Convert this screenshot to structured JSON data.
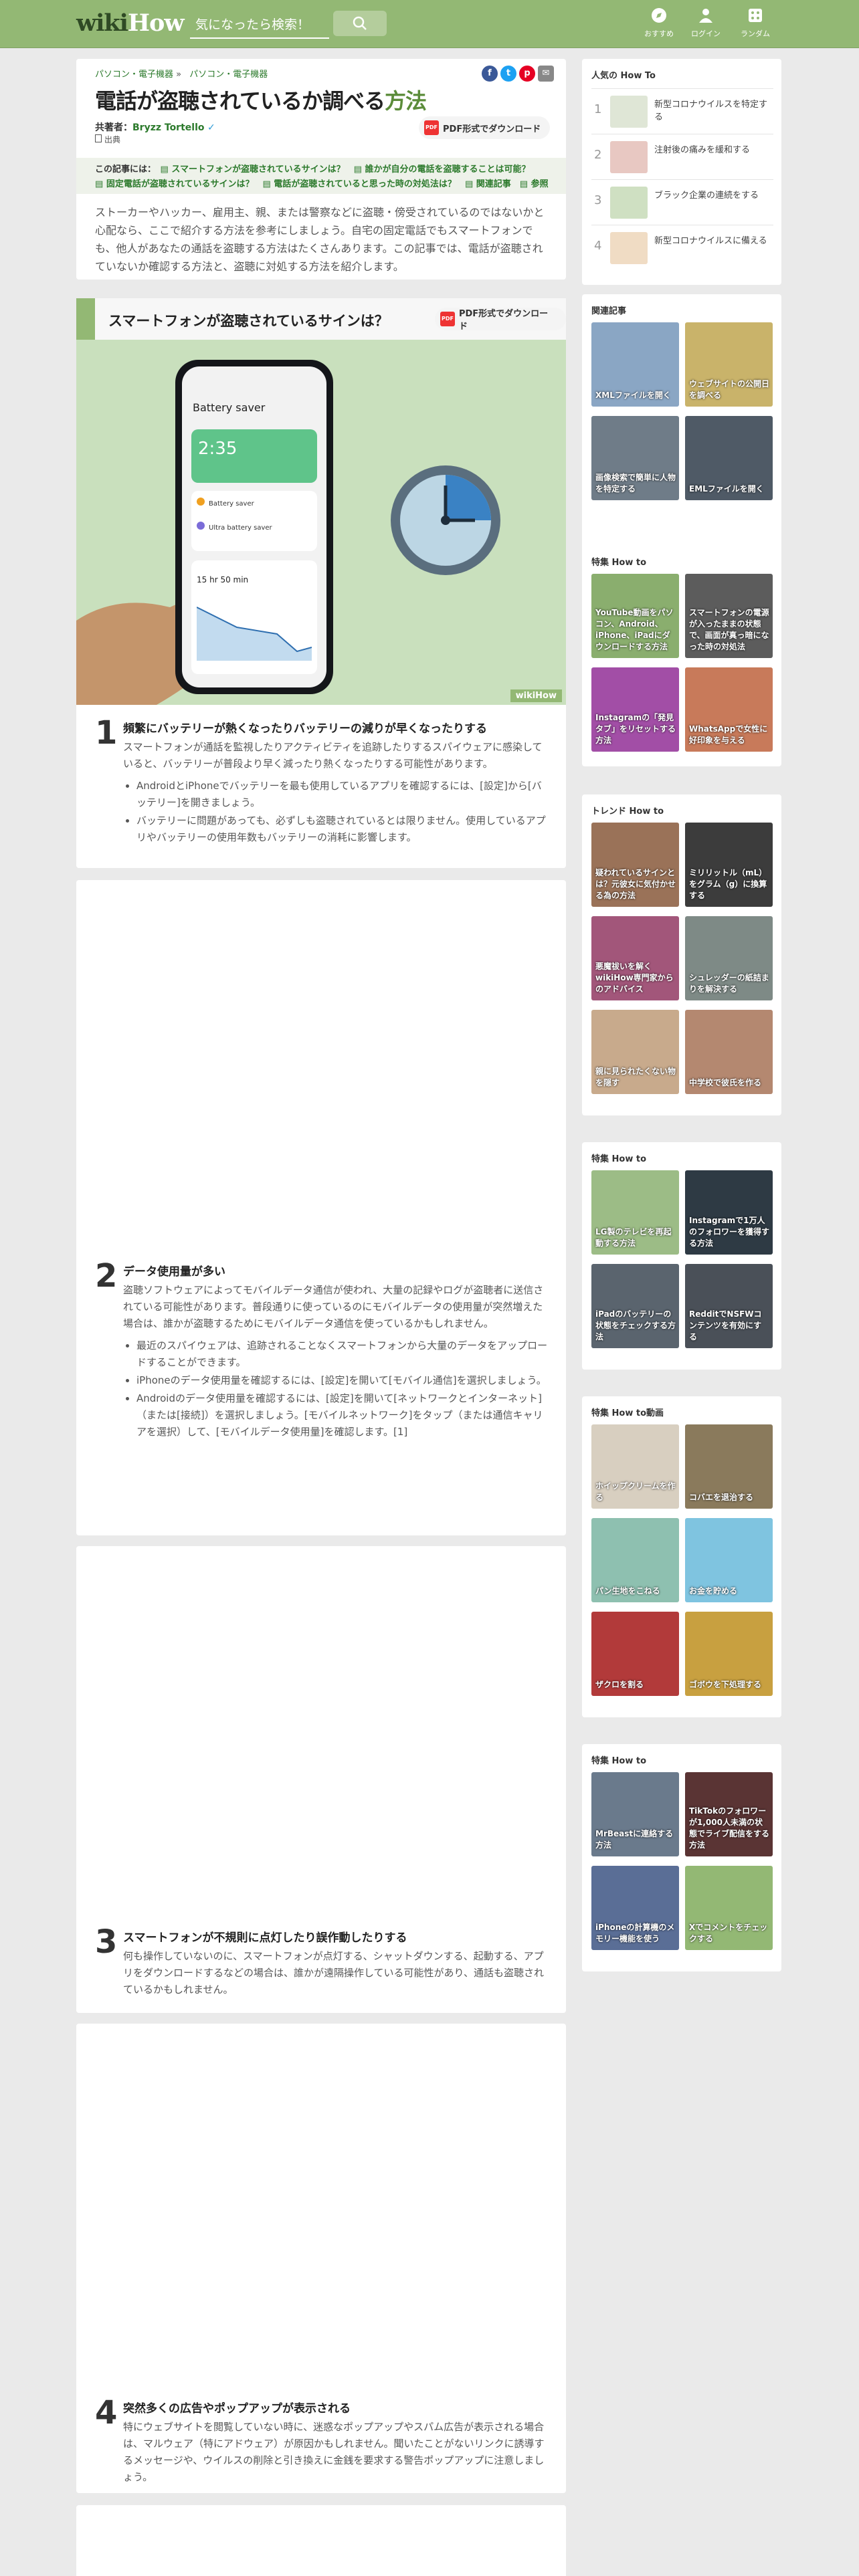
{
  "header": {
    "logo_wiki": "wiki",
    "logo_how": "How",
    "search_placeholder": "気になったら検索！",
    "nav": [
      {
        "label": "おすすめ",
        "icon": "compass-icon"
      },
      {
        "label": "ログイン",
        "icon": "user-icon"
      },
      {
        "label": "ランダム",
        "icon": "random-icon"
      }
    ]
  },
  "article": {
    "breadcrumb": [
      "パソコン・電子機器",
      "»",
      "パソコン・電子機器"
    ],
    "title_main": "電話が盗聴されているか調べる",
    "title_accent": "方法",
    "author_label": "共著者：",
    "author_name": "Bryzz Tortello",
    "pub_label": "出典",
    "pdf_label": "PDF形式でダウンロード",
    "toc_label": "この記事には：",
    "toc_items": [
      "スマートフォンが盗聴されているサインは？",
      "誰かが自分の電話を盗聴することは可能？",
      "固定電話が盗聴されているサインは？",
      "電話が盗聴されていると思った時の対処法は？",
      "関連記事",
      "参照"
    ],
    "intro": "ストーカーやハッカー、雇用主、親、または警察などに盗聴・傍受されているのではないかと心配なら、ここで紹介する方法を参考にしましょう。自宅の固定電話でもスマートフォンでも、他人があなたの通話を盗聴する方法はたくさんあります。この記事では、電話が盗聴されていないか確認する方法と、盗聴に対処する方法を紹介します。",
    "section_title": "スマートフォンが盗聴されているサインは？",
    "section_pdf": "PDF形式でダウンロード",
    "phone_screen": {
      "title": "Battery saver",
      "time": "2:35",
      "modes": [
        "Battery saver",
        "Ultra battery saver"
      ],
      "remaining": "15 hr 50 min",
      "watermark": "wikiHow"
    },
    "steps": [
      {
        "num": "1",
        "title": "頻繁にバッテリーが熱くなったりバッテリーの減りが早くなったりする",
        "text": "スマートフォンが通話を監視したりアクティビティを追跡したりするスパイウェアに感染していると、バッテリーが普段より早く減ったり熱くなったりする可能性があります。",
        "bullets": [
          "AndroidとiPhoneでバッテリーを最も使用しているアプリを確認するには、[設定]から[バッテリー]を開きましょう。",
          "バッテリーに問題があっても、必ずしも盗聴されているとは限りません。使用しているアプリやバッテリーの使用年数もバッテリーの消耗に影響します。"
        ]
      },
      {
        "num": "2",
        "title": "データ使用量が多い",
        "text": "盗聴ソフトウェアによってモバイルデータ通信が使われ、大量の記録やログが盗聴者に送信されている可能性があります。普段通りに使っているのにモバイルデータの使用量が突然増えた場合は、誰かが盗聴するためにモバイルデータ通信を使っているかもしれません。",
        "bullets": [
          "最近のスパイウェアは、追跡されることなくスマートフォンから大量のデータをアップロードすることができます。",
          "iPhoneのデータ使用量を確認するには、[設定]を開いて[モバイル通信]を選択しましょう。",
          "Androidのデータ使用量を確認するには、[設定]を開いて[ネットワークとインターネット]（または[接続]）を選択しましょう。[モバイルネットワーク]をタップ（または通信キャリアを選択）して、[モバイルデータ使用量]を確認します。[1]"
        ]
      },
      {
        "num": "3",
        "title": "スマートフォンが不規則に点灯したり誤作動したりする",
        "text": "何も操作していないのに、スマートフォンが点灯する、シャットダウンする、起動する、アプリをダウンロードするなどの場合は、誰かが遠隔操作している可能性があり、通話も盗聴されているかもしれません。",
        "bullets": []
      },
      {
        "num": "4",
        "title": "突然多くの広告やポップアップが表示される",
        "text": "特にウェブサイトを閲覧していない時に、迷惑なポップアップやスパム広告が表示される場合は、マルウェア（特にアドウェア）が原因かもしれません。聞いたことがないリンクに誘導するメッセージや、ウイルスの削除と引き換えに金銭を要求する警告ポップアップに注意しましょう。",
        "bullets": []
      }
    ]
  },
  "sidebar": {
    "popular": {
      "title": "人気の How To",
      "items": [
        {
          "num": "1",
          "title": "新型コロナウイルスを特定する"
        },
        {
          "num": "2",
          "title": "注射後の痛みを緩和する"
        },
        {
          "num": "3",
          "title": "ブラック企業の連続をする"
        },
        {
          "num": "4",
          "title": "新型コロナウイルスに備える"
        }
      ]
    },
    "related": {
      "title": "関連記事",
      "tiles": [
        "XMLファイルを開く",
        "ウェブサイトの公開日を調べる",
        "画像検索で簡単に人物を特定する",
        "EMLファイルを開く"
      ]
    },
    "featured1": {
      "title": "特集 How to",
      "tiles": [
        "YouTube動画をパソコン、Android、iPhone、iPadにダウンロードする方法",
        "スマートフォンの電源が入ったままの状態で、画面が真っ暗になった時の対処法",
        "Instagramの「発見タブ」をリセットする方法",
        "WhatsAppで女性に好印象を与える"
      ]
    },
    "trend": {
      "title": "トレンド How to",
      "tiles": [
        "疑われているサインとは？元彼女に気付かせる為の方法",
        "ミリリットル（mL）をグラム（g）に換算する",
        "悪魔祓いを解くwikiHow専門家からのアドバイス",
        "シュレッダーの紙詰まりを解決する",
        "親に見られたくない物を隠す",
        "中学校で彼氏を作る"
      ]
    },
    "featured2": {
      "title": "特集 How to",
      "tiles": [
        "LG製のテレビを再起動する方法",
        "Instagramで1万人のフォロワーを獲得する方法",
        "iPadのバッテリーの状態をチェックする方法",
        "RedditでNSFWコンテンツを有効にする"
      ]
    },
    "video": {
      "title": "特集 How to動画",
      "tiles": [
        "ホイップクリームを作る",
        "コバエを退治する",
        "パン生地をこねる",
        "お金を貯める",
        "ザクロを割る",
        "ゴボウを下処理する"
      ]
    },
    "featured3": {
      "title": "特集 How to",
      "tiles": [
        "MrBeastに連絡する方法",
        "TikTokのフォロワーが1,000人未満の状態でライブ配信をする方法",
        "iPhoneの計算機のメモリー機能を使う",
        "Xでコメントをチェックする"
      ]
    }
  },
  "colors": {
    "header": "#93b874",
    "accent": "#5b8c3a",
    "link": "#2c7a2c"
  }
}
